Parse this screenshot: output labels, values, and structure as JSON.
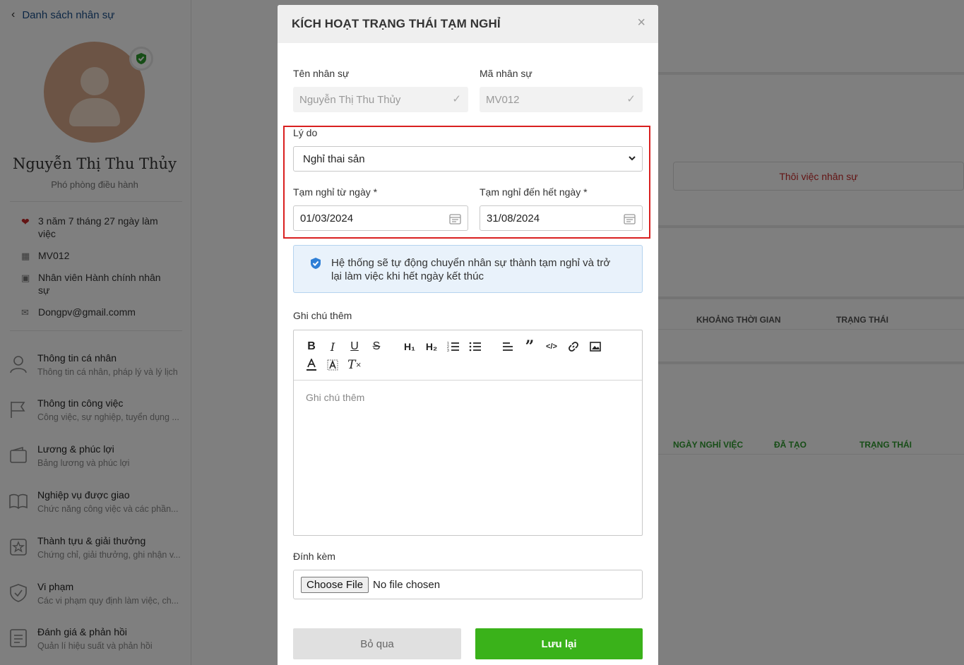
{
  "sidebar": {
    "back_label": "Danh sách nhân sự",
    "profile_name": "Nguyễn Thị Thu Thủy",
    "profile_role": "Phó phòng điều hành",
    "info": {
      "tenure": "3 năm 7 tháng 27 ngày làm việc",
      "code": "MV012",
      "position": "Nhân viên Hành chính nhân sự",
      "email": "Dongpv@gmail.comm"
    },
    "menu": [
      {
        "title": "Thông tin cá nhân",
        "sub": "Thông tin cá nhân, pháp lý và lý lịch",
        "icon": "user-icon"
      },
      {
        "title": "Thông tin công việc",
        "sub": "Công việc, sự nghiệp, tuyển dụng ...",
        "icon": "flag-icon"
      },
      {
        "title": "Lương & phúc lợi",
        "sub": "Bảng lương và phúc lợi",
        "icon": "wallet-icon"
      },
      {
        "title": "Nghiệp vụ được giao",
        "sub": "Chức năng công việc và các phần...",
        "icon": "book-icon"
      },
      {
        "title": "Thành tựu & giải thưởng",
        "sub": "Chứng chỉ, giải thưởng, ghi nhận v...",
        "icon": "award-icon"
      },
      {
        "title": "Vi phạm",
        "sub": "Các vi phạm quy định làm việc, ch...",
        "icon": "shield-check-icon"
      },
      {
        "title": "Đánh giá & phản hồi",
        "sub": "Quản lí hiệu suất và phản hồi",
        "icon": "list-icon"
      }
    ]
  },
  "background": {
    "quit_button": "Thôi việc nhân sự",
    "table1_cols": [
      "KHOẢNG THỜI GIAN",
      "TRẠNG THÁI"
    ],
    "table2_cols": [
      "NGÀY NGHỈ VIỆC",
      "ĐÃ TẠO",
      "TRẠNG THÁI"
    ]
  },
  "modal": {
    "title": "KÍCH HOẠT TRẠNG THÁI TẠM NGHỈ",
    "employee_name_label": "Tên nhân sự",
    "employee_name_value": "Nguyễn Thị Thu Thủy",
    "employee_code_label": "Mã nhân sự",
    "employee_code_value": "MV012",
    "reason_label": "Lý do",
    "reason_value": "Nghỉ thai sản",
    "from_label": "Tạm nghỉ từ ngày *",
    "from_value": "01/03/2024",
    "to_label": "Tạm nghỉ đến hết ngày *",
    "to_value": "31/08/2024",
    "notice": "Hệ thống sẽ tự động chuyển nhân sự thành tạm nghỉ và trở lại làm việc khi hết ngày kết thúc",
    "note_label": "Ghi chú thêm",
    "note_placeholder": "Ghi chú thêm",
    "attach_label": "Đính kèm",
    "choose_file": "Choose File",
    "no_file": "No file chosen",
    "cancel": "Bỏ qua",
    "save": "Lưu lại"
  },
  "colors": {
    "accent_green": "#3ab21a",
    "highlight_red": "#d92020",
    "link_blue": "#1a4f8a",
    "danger_text": "#c62828"
  }
}
